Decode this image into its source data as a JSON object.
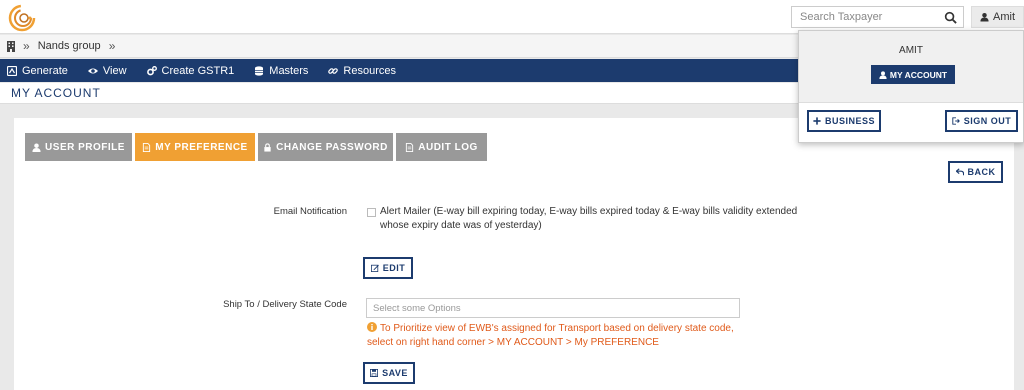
{
  "header": {
    "search_placeholder": "Search Taxpayer",
    "user_name": "Amit"
  },
  "breadcrumb": {
    "items": [
      "Nands group"
    ],
    "separator": "»"
  },
  "nav": {
    "items": [
      {
        "label": "Generate",
        "icon": "generate-icon"
      },
      {
        "label": "View",
        "icon": "eye-icon"
      },
      {
        "label": "Create GSTR1",
        "icon": "cogs-icon"
      },
      {
        "label": "Masters",
        "icon": "database-icon"
      },
      {
        "label": "Resources",
        "icon": "link-icon"
      }
    ]
  },
  "page_title": "MY ACCOUNT",
  "tabs": [
    {
      "label": "USER PROFILE",
      "icon": "user-icon",
      "active": false
    },
    {
      "label": "MY PREFERENCE",
      "icon": "file-icon",
      "active": true
    },
    {
      "label": "CHANGE PASSWORD",
      "icon": "lock-icon",
      "active": false
    },
    {
      "label": "AUDIT LOG",
      "icon": "file-icon",
      "active": false
    }
  ],
  "back_label": "BACK",
  "email_notification": {
    "label": "Email Notification",
    "option_text": "Alert Mailer (E-way bill expiring today, E-way bills expired today & E-way bills validity extended whose expiry date was of yesterday)",
    "checked": false,
    "edit_label": "EDIT"
  },
  "ship_to": {
    "label": "Ship To / Delivery State Code",
    "placeholder": "Select some Options",
    "info_text": "To Prioritize view of EWB's assigned for Transport based on delivery state code, select on right hand corner > MY ACCOUNT > My PREFERENCE",
    "save_label": "SAVE"
  },
  "user_dropdown": {
    "name": "AMIT",
    "my_account_label": "MY ACCOUNT",
    "business_label": "BUSINESS",
    "signout_label": "SIGN OUT"
  },
  "colors": {
    "navy": "#1c3b6e",
    "orange": "#f0a033",
    "tab_gray": "#999999",
    "warning": "#e05a1a"
  }
}
